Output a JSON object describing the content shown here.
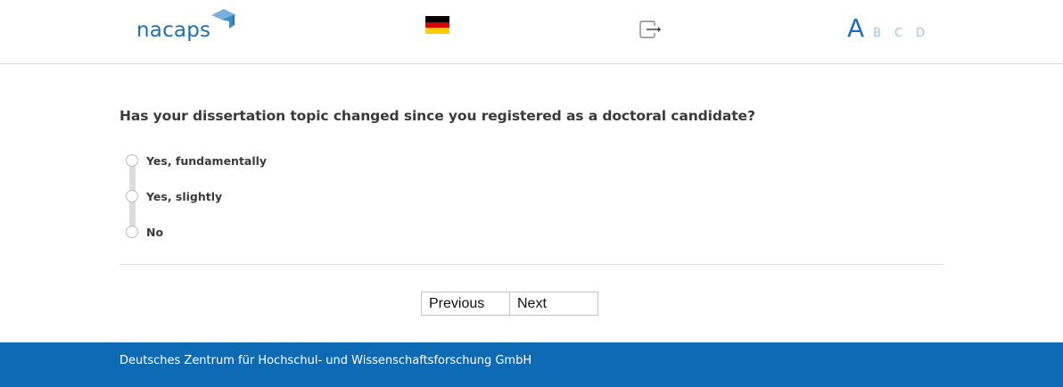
{
  "header": {
    "logo_text": "nacaps",
    "language_flag": "german-flag-icon",
    "logout_icon": "logout-icon",
    "font_size": {
      "large": "A",
      "small_options": [
        "B",
        "C",
        "D"
      ]
    }
  },
  "question": {
    "text": "Has your dissertation topic changed since you registered as a doctoral candidate?",
    "options": [
      {
        "label": "Yes, fundamentally",
        "selected": false
      },
      {
        "label": "Yes, slightly",
        "selected": false
      },
      {
        "label": "No",
        "selected": false
      }
    ]
  },
  "navigation": {
    "previous_label": "Previous",
    "next_label": "Next"
  },
  "footer": {
    "text": "Deutsches Zentrum für Hochschul- und Wissenschaftsforschung GmbH"
  },
  "colors": {
    "brand_blue": "#1f6fb5",
    "footer_blue": "#0d6ab3",
    "light_blue": "#9cc3e6",
    "text_dark": "#3a3a3a"
  }
}
